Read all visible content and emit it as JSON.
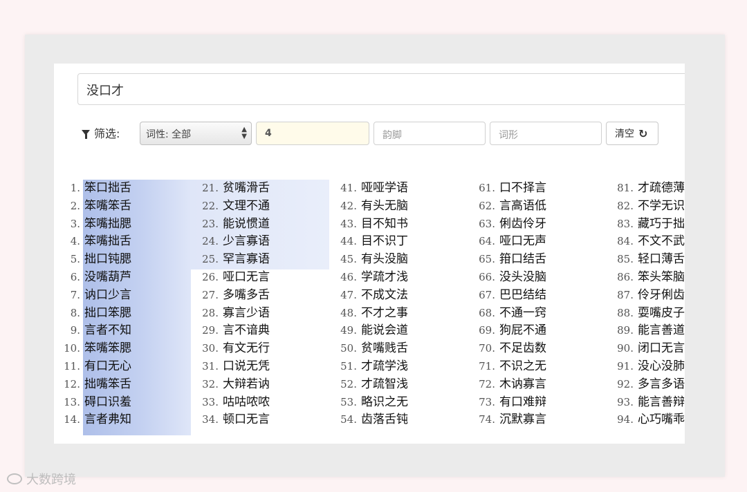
{
  "search": {
    "value": "没口才"
  },
  "filters": {
    "label": "筛选:",
    "pos_select": "词性: 全部",
    "length_value": "4",
    "rhyme_placeholder": "韵脚",
    "form_placeholder": "词形",
    "clear_label": "清空"
  },
  "columns": [
    {
      "nums": [
        "1.",
        "2.",
        "3.",
        "4.",
        "5.",
        "6.",
        "7.",
        "8.",
        "9.",
        "10.",
        "11.",
        "12.",
        "13.",
        "14."
      ],
      "words": [
        "笨口拙舌",
        "笨嘴笨舌",
        "笨嘴拙腮",
        "笨嘴拙舌",
        "拙口钝腮",
        "没嘴葫芦",
        "讷口少言",
        "拙口笨腮",
        "言者不知",
        "笨嘴笨腮",
        "有口无心",
        "拙嘴笨舌",
        "碍口识羞",
        "言者弗知"
      ]
    },
    {
      "nums": [
        "21.",
        "22.",
        "23.",
        "24.",
        "25.",
        "26.",
        "27.",
        "28.",
        "29.",
        "30.",
        "31.",
        "32.",
        "33.",
        "34."
      ],
      "words": [
        "贫嘴滑舌",
        "文理不通",
        "能说惯道",
        "少言寡语",
        "罕言寡语",
        "哑口无言",
        "多嘴多舌",
        "寡言少语",
        "言不谙典",
        "有文无行",
        "口说无凭",
        "大辩若讷",
        "咕咕哝哝",
        "顿口无言"
      ]
    },
    {
      "nums": [
        "41.",
        "42.",
        "43.",
        "44.",
        "45.",
        "46.",
        "47.",
        "48.",
        "49.",
        "50.",
        "51.",
        "52.",
        "53.",
        "54."
      ],
      "words": [
        "哑哑学语",
        "有头无脑",
        "目不知书",
        "目不识丁",
        "有头没脑",
        "学疏才浅",
        "不成文法",
        "不才之事",
        "能说会道",
        "贫嘴贱舌",
        "才疏学浅",
        "才疏智浅",
        "略识之无",
        "齿落舌钝"
      ]
    },
    {
      "nums": [
        "61.",
        "62.",
        "63.",
        "64.",
        "65.",
        "66.",
        "67.",
        "68.",
        "69.",
        "70.",
        "71.",
        "72.",
        "73.",
        "74."
      ],
      "words": [
        "口不择言",
        "言高语低",
        "俐齿伶牙",
        "哑口无声",
        "箝口结舌",
        "没头没脑",
        "巴巴结结",
        "不通一窍",
        "狗屁不通",
        "不足齿数",
        "不识之无",
        "木讷寡言",
        "有口难辩",
        "沉默寡言"
      ]
    },
    {
      "nums": [
        "81.",
        "82.",
        "83.",
        "84.",
        "85.",
        "86.",
        "87.",
        "88.",
        "89.",
        "90.",
        "91.",
        "92.",
        "93.",
        "94."
      ],
      "words": [
        "才疏德薄",
        "不学无识",
        "藏巧于拙",
        "不文不武",
        "轻口薄舌",
        "笨头笨脑",
        "伶牙俐齿",
        "耍嘴皮子",
        "能言善道",
        "闭口无言",
        "没心没肺",
        "多言多语",
        "能言善辩",
        "心巧嘴乖"
      ]
    }
  ],
  "watermark": {
    "text": "大数跨境"
  }
}
